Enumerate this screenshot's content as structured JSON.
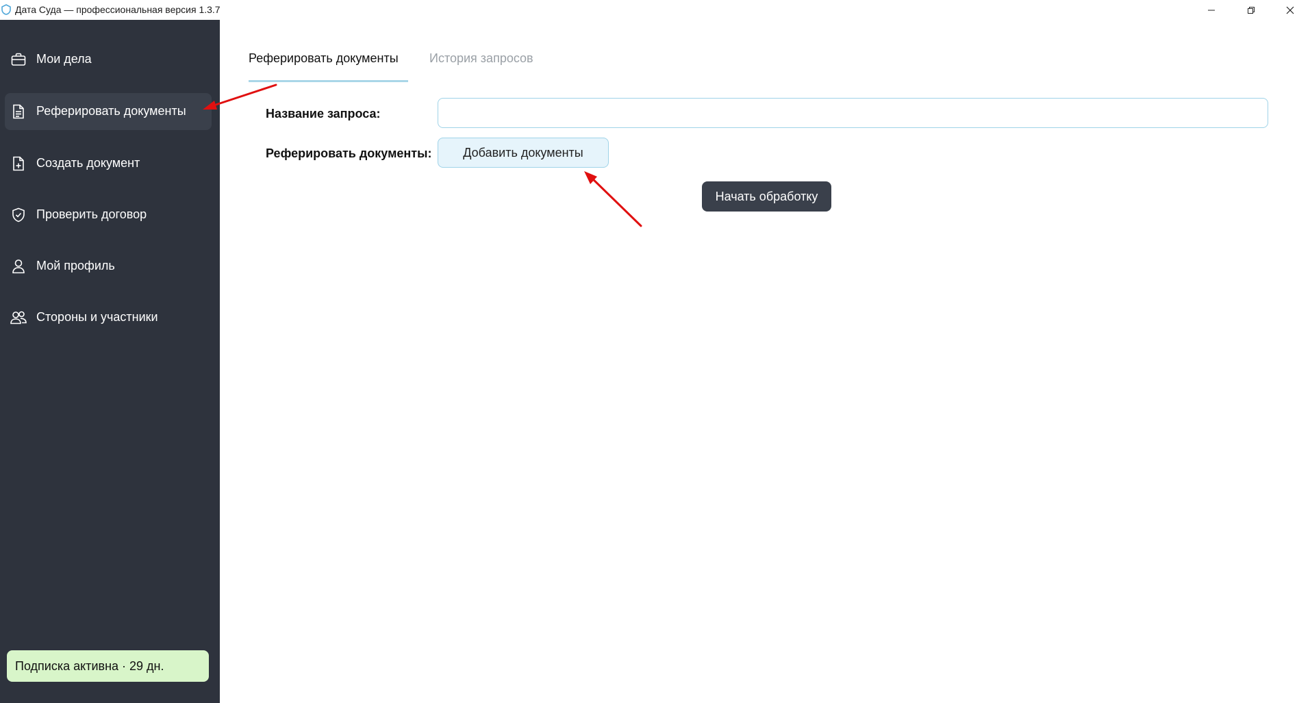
{
  "window": {
    "title": "Дата Суда — профессиональная версия 1.3.7",
    "controls": [
      "minimize",
      "restore",
      "close"
    ]
  },
  "sidebar": {
    "items": [
      {
        "label": "Мои дела",
        "icon": "briefcase-icon",
        "active": false
      },
      {
        "label": "Реферировать документы",
        "icon": "document-icon",
        "active": true
      },
      {
        "label": "Создать документ",
        "icon": "file-plus-icon",
        "active": false
      },
      {
        "label": "Проверить договор",
        "icon": "shield-check-icon",
        "active": false
      },
      {
        "label": "Мой профиль",
        "icon": "user-icon",
        "active": false
      },
      {
        "label": "Стороны и участники",
        "icon": "users-icon",
        "active": false
      }
    ],
    "subscription": "Подписка активна · 29 дн."
  },
  "main": {
    "tabs": [
      {
        "label": "Реферировать документы",
        "active": true
      },
      {
        "label": "История запросов",
        "active": false
      }
    ],
    "form": {
      "name_label": "Название запроса:",
      "name_value": "",
      "refer_label": "Реферировать документы:",
      "add_button": "Добавить документы",
      "start_button": "Начать обработку"
    }
  },
  "colors": {
    "sidebar_bg": "#2e333d",
    "accent_border": "#9fd3e8",
    "subscription_bg": "#d8f5c9",
    "annotation_arrow": "#e01010"
  }
}
